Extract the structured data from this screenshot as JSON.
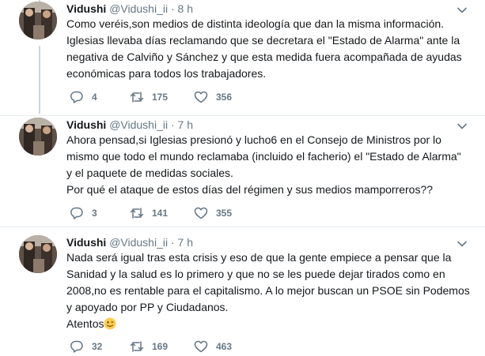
{
  "tweets": [
    {
      "name": "Vidushi",
      "handle": "@Vidushi_ii",
      "dot": "·",
      "time": "8 h",
      "lines": [
        "Como veréis,son medios de distinta ideología que dan la misma información.",
        "Iglesias llevaba días reclamando que se decretara el \"Estado de Alarma\" ante la",
        "negativa de Calviño y Sánchez y que esta medida fuera acompañada de ayudas",
        "económicas para todos los trabajadores."
      ],
      "replies": "4",
      "retweets": "175",
      "likes": "356"
    },
    {
      "name": "Vidushi",
      "handle": "@Vidushi_ii",
      "dot": "·",
      "time": "7 h",
      "lines": [
        "Ahora pensad,si Iglesias presionó y lucho6 en el Consejo de Ministros por lo",
        "mismo que todo el mundo reclamaba (incluido el facherio) el \"Estado de Alarma\"",
        "y el paquete de medidas sociales.",
        "Por qué el ataque de estos días del régimen y sus medios mamporreros??"
      ],
      "replies": "3",
      "retweets": "141",
      "likes": "355"
    },
    {
      "name": "Vidushi",
      "handle": "@Vidushi_ii",
      "dot": "·",
      "time": "7 h",
      "lines": [
        "Nada será igual tras esta crisis y eso de que la gente empiece a pensar que la",
        "Sanidad y la salud es lo primero y que no se les puede dejar tirados como en",
        "2008,no es rentable para el capitalismo. A lo mejor buscan un PSOE sin Podemos",
        "y apoyado por PP y Ciudadanos.",
        "Atentos"
      ],
      "replies": "32",
      "retweets": "169",
      "likes": "463"
    }
  ],
  "icons": {
    "reply": "reply-icon",
    "retweet": "retweet-icon",
    "like": "heart-icon",
    "caret": "chevron-down-icon",
    "emoji": "winking-face-emoji-icon"
  },
  "colors": {
    "text": "#14171a",
    "secondary": "#657786",
    "divider": "#e6ecf0",
    "thread_line": "#ccd6dd",
    "emoji": "#ffcc4d"
  }
}
